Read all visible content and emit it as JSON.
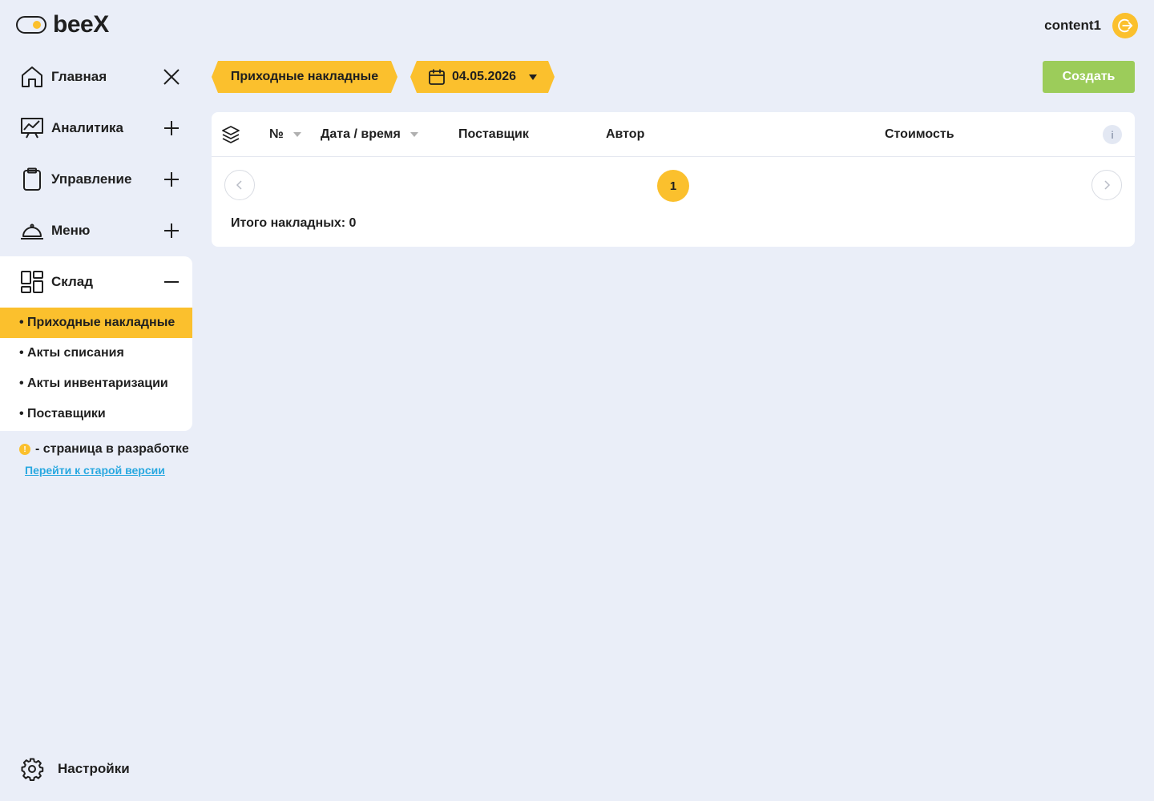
{
  "brand": {
    "name": "beeX",
    "accent": "#fbc02d",
    "success": "#9ccc5a",
    "link": "#29a8e0"
  },
  "header": {
    "username": "content1",
    "logout_icon": "logout-icon"
  },
  "sidebar": {
    "items": [
      {
        "label": "Главная",
        "icon": "home-icon",
        "toggle": "close"
      },
      {
        "label": "Аналитика",
        "icon": "analytics-icon",
        "toggle": "plus"
      },
      {
        "label": "Управление",
        "icon": "clipboard-icon",
        "toggle": "plus"
      },
      {
        "label": "Меню",
        "icon": "cloche-icon",
        "toggle": "plus"
      },
      {
        "label": "Склад",
        "icon": "grid-icon",
        "toggle": "minus"
      }
    ],
    "warehouse_sub": [
      {
        "label": "• Приходные накладные",
        "active": true
      },
      {
        "label": "• Акты списания",
        "active": false
      },
      {
        "label": "• Акты инвентаризации",
        "active": false
      },
      {
        "label": "• Поставщики",
        "active": false
      }
    ],
    "dev_note": "- страница в разработке",
    "dev_mark": "!",
    "old_version_link": "Перейти к старой версии",
    "settings": "Настройки"
  },
  "toolbar": {
    "title": "Приходные накладные",
    "date": "04.05.2026",
    "create": "Создать"
  },
  "table": {
    "columns": [
      "№",
      "Дата / время",
      "Поставщик",
      "Автор",
      "Стоимость"
    ],
    "info": "i",
    "current_page": "1",
    "total": "Итого накладных: 0"
  }
}
